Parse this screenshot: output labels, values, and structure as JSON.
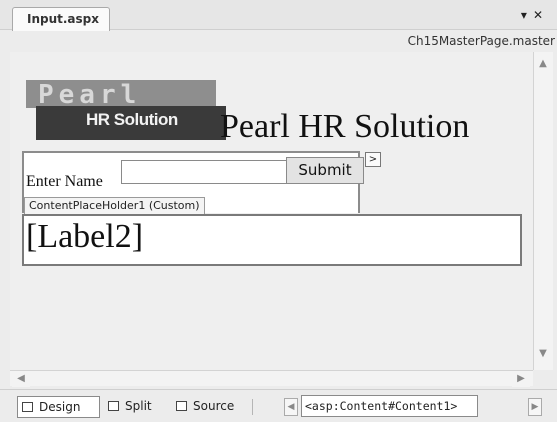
{
  "tab": {
    "title": "Input.aspx",
    "dropdown_icon": "▾",
    "close_icon": "✕"
  },
  "master": {
    "label": "Ch15MasterPage.master"
  },
  "header": {
    "logo_brand": "Pearl",
    "logo_sub": "HR Solution",
    "title": "Pearl HR Solution"
  },
  "form": {
    "enter_label": "Enter Name",
    "name_value": "",
    "submit_label": "Submit",
    "smart_tag_icon": ">"
  },
  "content": {
    "placeholder_tag": "ContentPlaceHolder1 (Custom)",
    "label2": "[Label2]"
  },
  "scroll": {
    "up": "▲",
    "down": "▼",
    "left": "◀",
    "right": "▶"
  },
  "viewbar": {
    "design": "Design",
    "split": "Split",
    "source": "Source",
    "breadcrumb": "<asp:Content#Content1>",
    "nav_left": "◀",
    "nav_right": "▶"
  }
}
